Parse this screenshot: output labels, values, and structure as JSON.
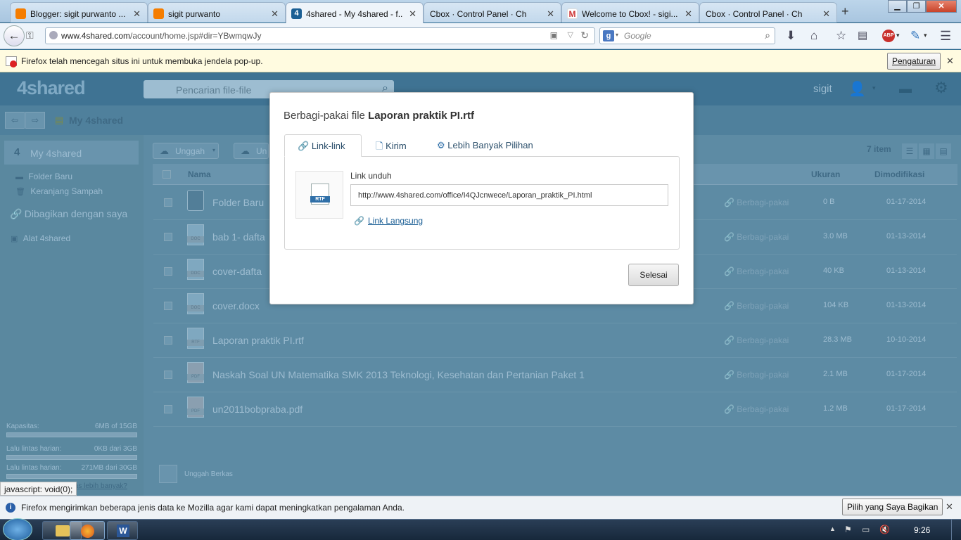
{
  "tabs": [
    {
      "title": "Blogger: sigit purwanto ...",
      "icon": "blogger-icon"
    },
    {
      "title": "sigit purwanto",
      "icon": "blogger-icon"
    },
    {
      "title": "4shared - My 4shared - f...",
      "icon": "4shared-icon",
      "active": true
    },
    {
      "title": "Cbox · Control Panel · Chat ...",
      "icon": "none"
    },
    {
      "title": "Welcome to Cbox! - sigi...",
      "icon": "gmail-icon"
    },
    {
      "title": "Cbox · Control Panel · Chat ...",
      "icon": "none"
    }
  ],
  "nav": {
    "url_domain": "www.4shared.com",
    "url_path": "/account/home.jsp#dir=YBwmqwJy",
    "search_placeholder": "Google"
  },
  "popup_notice": {
    "text": "Firefox telah mencegah situs ini untuk membuka jendela pop-up.",
    "button": "Pengaturan"
  },
  "site": {
    "logo": "4shared",
    "search_placeholder": "Pencarian file-file",
    "user": "sigit",
    "breadcrumb": "My 4shared",
    "upload_label": "Unggah",
    "upload2_label": "Un",
    "item_count": "7 item",
    "columns": {
      "name": "Nama",
      "size": "Ukuran",
      "modified": "Dimodifikasi"
    },
    "sidebar": {
      "my4shared": "My 4shared",
      "folder_baru": "Folder Baru",
      "keranjang": "Keranjang Sampah",
      "dibagikan": "Dibagikan dengan saya",
      "alat": "Alat 4shared",
      "kapasitas_label": "Kapasitas:",
      "kapasitas_val": "6MB of 15GB",
      "lalu1_label": "Lalu lintas harian:",
      "lalu1_val": "0KB dari 3GB",
      "lalu2_label": "Lalu lintas harian:",
      "lalu2_val": "271MB dari 30GB",
      "more_link": "tas lebih banyak?"
    },
    "files": [
      {
        "name": "Folder Baru",
        "type": "folder",
        "share": "Berbagi-pakai",
        "size": "0 B",
        "date": "01-17-2014"
      },
      {
        "name": "bab 1- dafta",
        "type": "DOC",
        "share": "Berbagi-pakai",
        "size": "3.0 MB",
        "date": "01-13-2014"
      },
      {
        "name": "cover-dafta",
        "type": "DOC",
        "share": "Berbagi-pakai",
        "size": "40 KB",
        "date": "01-13-2014"
      },
      {
        "name": "cover.docx",
        "type": "DOC",
        "share": "Berbagi-pakai",
        "size": "104 KB",
        "date": "01-13-2014"
      },
      {
        "name": "Laporan praktik PI.rtf",
        "type": "RTF",
        "share": "Berbagi-pakai",
        "size": "28.3 MB",
        "date": "10-10-2014"
      },
      {
        "name": "Naskah Soal UN Matematika SMK 2013 Teknologi, Kesehatan dan Pertanian Paket 1",
        "type": "PDF",
        "share": "Berbagi-pakai",
        "size": "2.1 MB",
        "date": "01-17-2014"
      },
      {
        "name": "un2011bobpraba.pdf",
        "type": "PDF",
        "share": "Berbagi-pakai",
        "size": "1.2 MB",
        "date": "01-17-2014"
      }
    ],
    "upload_footer": "Unggah Berkas"
  },
  "modal": {
    "title_prefix": "Berbagi-pakai file",
    "title_file": "Laporan praktik PI.rtf",
    "tabs": [
      "Link-link",
      "Kirim",
      "Lebih Banyak Pilihan"
    ],
    "file_badge": "RTF",
    "link_label": "Link unduh",
    "link_value": "http://www.4shared.com/office/I4QJcnwece/Laporan_praktik_PI.html",
    "direct_link": "Link Langsung",
    "done_button": "Selesai"
  },
  "status_text": "javascript: void(0);",
  "data_notice": {
    "text": "Firefox mengirimkan beberapa jenis data ke Mozilla agar kami dapat meningkatkan pengalaman Anda.",
    "button": "Pilih yang Saya Bagikan"
  },
  "taskbar": {
    "clock": "9:26"
  }
}
